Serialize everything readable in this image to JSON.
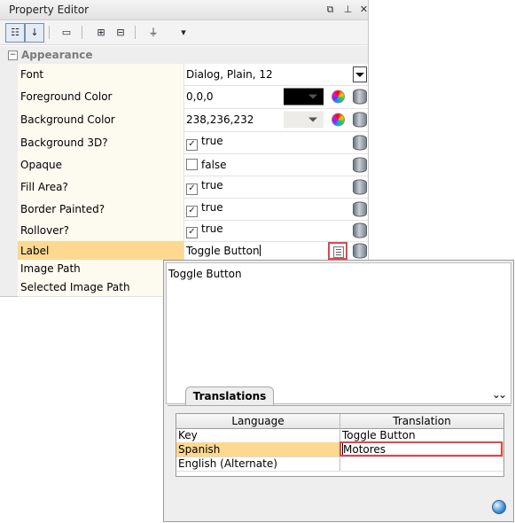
{
  "window": {
    "title": "Property Editor",
    "buttons": [
      "restore-icon",
      "pin-icon",
      "close-icon"
    ]
  },
  "toolbar": {
    "items": [
      "categorized-sort-icon",
      "alphabetical-sort-icon",
      "customizer-icon",
      "expand-all-icon",
      "collapse-all-icon",
      "filter-icon",
      "dropdown-arrow-icon"
    ]
  },
  "category": {
    "name": "Appearance",
    "expander": "−"
  },
  "properties": [
    {
      "name": "Font",
      "value": "Dialog, Plain, 12"
    },
    {
      "name": "Foreground Color",
      "value": "0,0,0",
      "color": "#000000"
    },
    {
      "name": "Background Color",
      "value": "238,236,232",
      "color": "#eeece8"
    },
    {
      "name": "Background 3D?",
      "value": "true",
      "checked": true
    },
    {
      "name": "Opaque",
      "value": "false",
      "checked": false
    },
    {
      "name": "Fill Area?",
      "value": "true",
      "checked": true
    },
    {
      "name": "Border Painted?",
      "value": "true",
      "checked": true
    },
    {
      "name": "Rollover?",
      "value": "true",
      "checked": true
    },
    {
      "name": "Label",
      "value": "Toggle Button"
    },
    {
      "name": "Image Path",
      "value": ""
    },
    {
      "name": "Selected Image Path",
      "value": ""
    }
  ],
  "popup": {
    "text": "Toggle Button",
    "tab": "Translations",
    "chevron": "»",
    "table": {
      "headers": [
        "Language",
        "Translation"
      ],
      "rows": [
        {
          "language": "Key",
          "translation": "Toggle Button"
        },
        {
          "language": "Spanish",
          "translation": "Motores"
        },
        {
          "language": "English (Alternate)",
          "translation": ""
        }
      ]
    }
  },
  "colors": {
    "selected_row": "#fcd890",
    "highlight_border": "#e0464e",
    "name_column": "#fdfaf0"
  }
}
